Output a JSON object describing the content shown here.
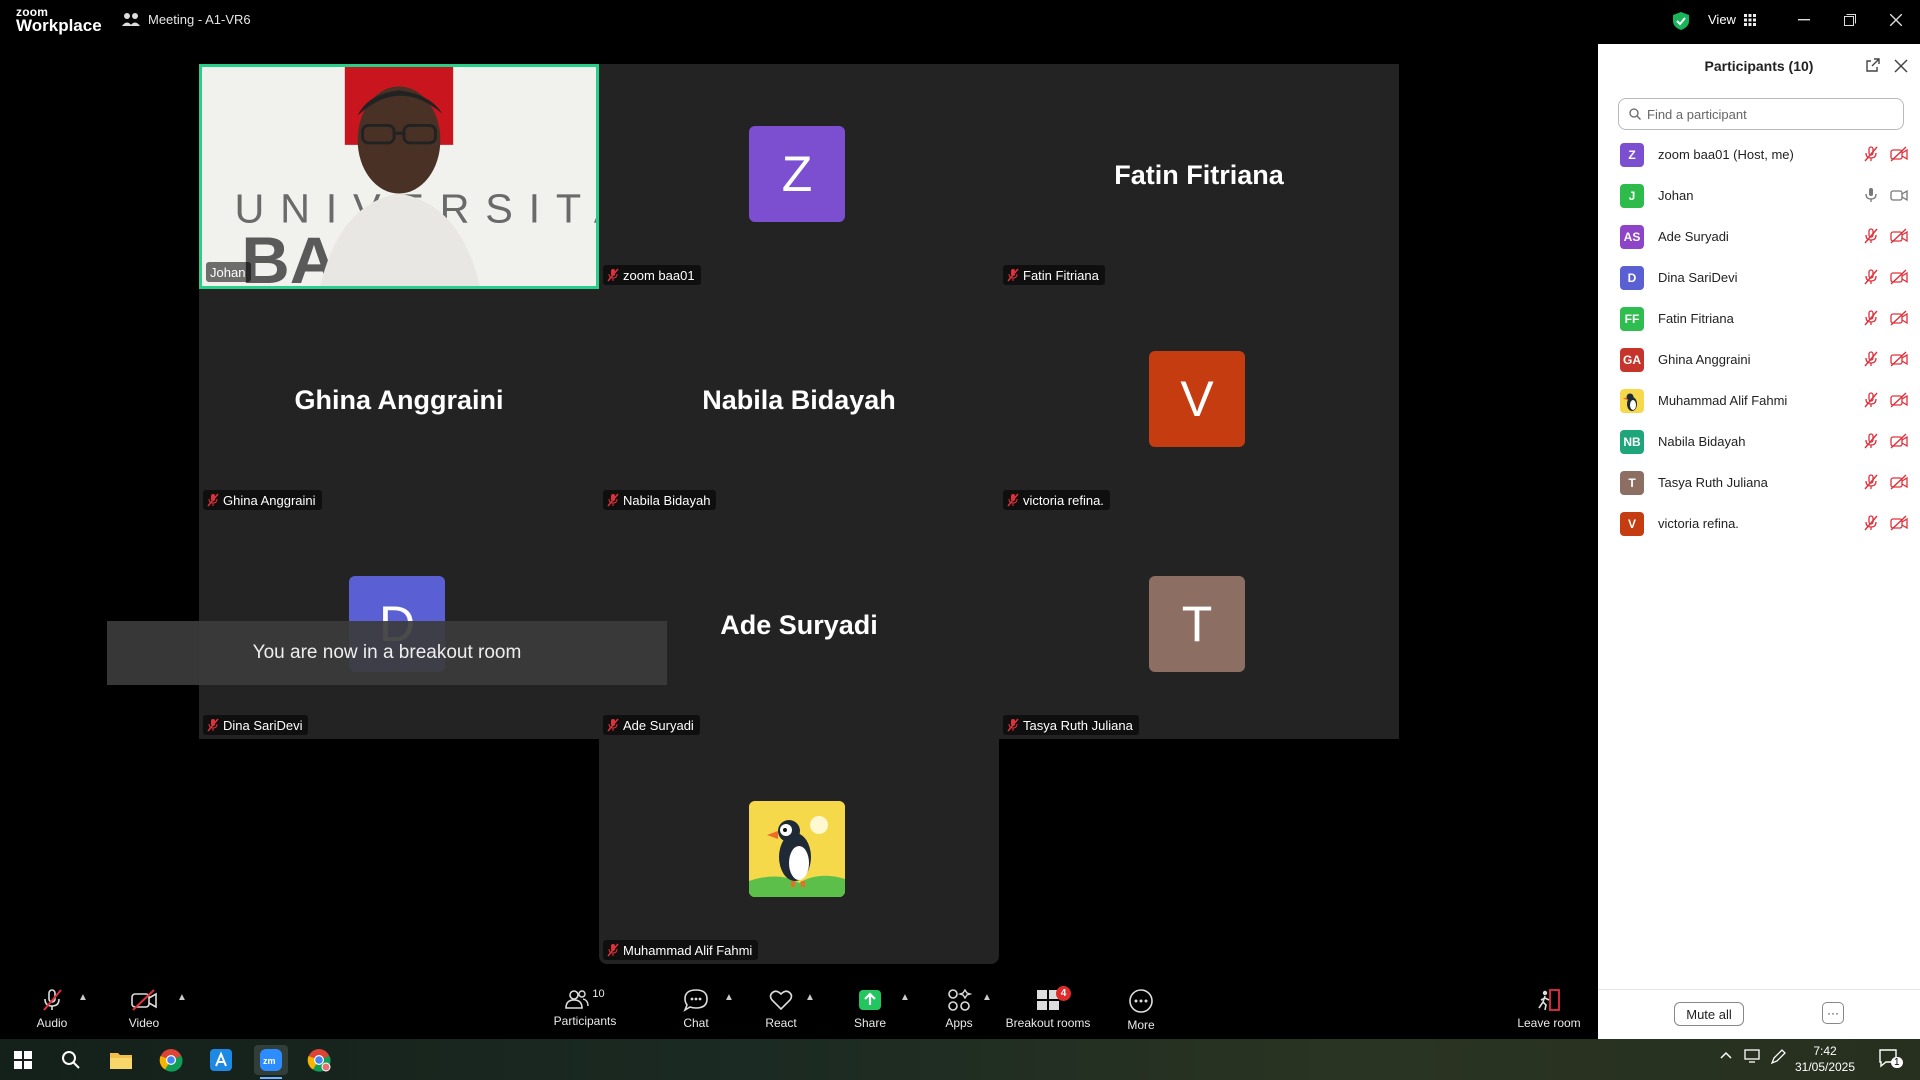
{
  "window": {
    "brand_top": "zoom",
    "brand_bottom": "Workplace",
    "meeting_title": "Meeting - A1-VR6",
    "view_label": "View"
  },
  "tiles": [
    {
      "name": "Johan",
      "type": "video",
      "overlay_text": "UNIVERSITAS BALE"
    },
    {
      "name": "zoom baa01",
      "type": "avatar",
      "initial": "Z",
      "color": "#7c4fd0"
    },
    {
      "name": "Fatin Fitriana",
      "type": "name",
      "big": "Fatin Fitriana"
    },
    {
      "name": "Ghina Anggraini",
      "type": "name",
      "big": "Ghina Anggraini"
    },
    {
      "name": "Nabila Bidayah",
      "type": "name",
      "big": "Nabila Bidayah"
    },
    {
      "name": "victoria refina.",
      "type": "avatar",
      "initial": "V",
      "color": "#c63c11"
    },
    {
      "name": "Dina SariDevi",
      "type": "avatar",
      "initial": "D",
      "color": "#5a5fd4"
    },
    {
      "name": "Ade Suryadi",
      "type": "name",
      "big": "Ade Suryadi"
    },
    {
      "name": "Tasya Ruth Juliana",
      "type": "avatar",
      "initial": "T",
      "color": "#8d6e63"
    },
    {
      "name": "Muhammad Alif Fahmi",
      "type": "puffin"
    }
  ],
  "toast": "You are now in a breakout room",
  "panel": {
    "title": "Participants (10)",
    "search_placeholder": "Find a participant",
    "participants": [
      {
        "initials": "Z",
        "name": "zoom baa01 (Host, me)",
        "color": "#7c4fd0",
        "audio": "muted",
        "video": "off"
      },
      {
        "initials": "J",
        "name": "Johan",
        "color": "#2dbb4c",
        "audio": "on",
        "video": "on"
      },
      {
        "initials": "AS",
        "name": "Ade Suryadi",
        "color": "#8e44c8",
        "audio": "muted",
        "video": "off"
      },
      {
        "initials": "D",
        "name": "Dina SariDevi",
        "color": "#5a5fd4",
        "audio": "muted",
        "video": "off"
      },
      {
        "initials": "FF",
        "name": "Fatin Fitriana",
        "color": "#2fbd4f",
        "audio": "muted",
        "video": "off"
      },
      {
        "initials": "GA",
        "name": "Ghina Anggraini",
        "color": "#c7342b",
        "audio": "muted",
        "video": "off"
      },
      {
        "initials": "",
        "name": "Muhammad Alif Fahmi",
        "color": "#f5c842",
        "audio": "muted",
        "video": "off"
      },
      {
        "initials": "NB",
        "name": "Nabila Bidayah",
        "color": "#1fa57a",
        "audio": "muted",
        "video": "off"
      },
      {
        "initials": "T",
        "name": "Tasya Ruth Juliana",
        "color": "#8d6e63",
        "audio": "muted",
        "video": "off"
      },
      {
        "initials": "V",
        "name": "victoria refina.",
        "color": "#c63c11",
        "audio": "muted",
        "video": "off"
      }
    ],
    "mute_all": "Mute all",
    "more": "···"
  },
  "toolbar": {
    "audio": "Audio",
    "video": "Video",
    "participants": "Participants",
    "participants_count": "10",
    "chat": "Chat",
    "react": "React",
    "share": "Share",
    "apps": "Apps",
    "breakout": "Breakout rooms",
    "breakout_badge": "4",
    "more": "More",
    "leave": "Leave room"
  },
  "taskbar": {
    "time": "7:42",
    "date": "31/05/2025",
    "notif_count": "1"
  },
  "colors": {
    "accent_green": "#27d08a",
    "muted_red": "#e0303a",
    "share_green": "#22c55e"
  }
}
